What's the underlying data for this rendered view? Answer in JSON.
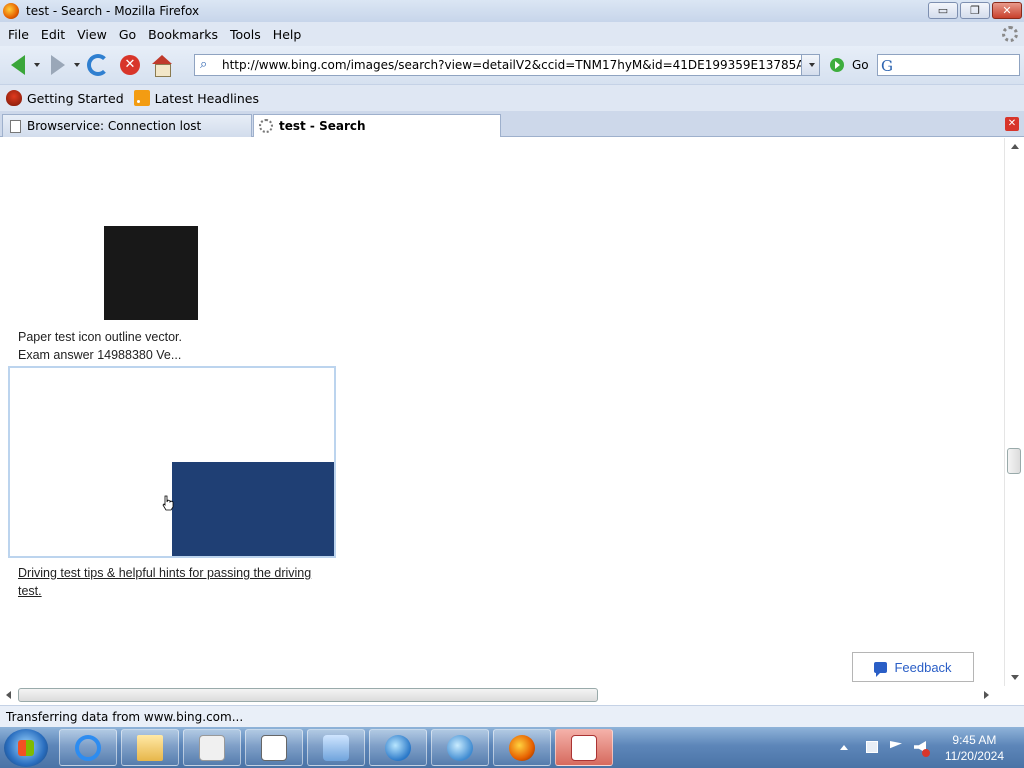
{
  "window": {
    "title": "test - Search - Mozilla Firefox",
    "minimize": "▭",
    "restore": "❐",
    "close": "✕"
  },
  "menu": [
    "File",
    "Edit",
    "View",
    "Go",
    "Bookmarks",
    "Tools",
    "Help"
  ],
  "navbar": {
    "url": "http://www.bing.com/images/search?view=detailV2&ccid=TNM17hyM&id=41DE199359E13785A78F114426BA",
    "go_label": "Go",
    "search_placeholder": ""
  },
  "bookmarks": [
    "Getting Started",
    "Latest Headlines"
  ],
  "tabs": [
    {
      "label": "Browservice: Connection lost",
      "active": false
    },
    {
      "label": "test - Search",
      "active": true
    }
  ],
  "content": {
    "caption1_line1": "Paper test icon outline vector.",
    "caption1_line2": "Exam answer 14988380 Ve...",
    "caption2_line1": "Driving test tips & helpful hints for passing the driving",
    "caption2_line2": "test.",
    "feedback_label": "Feedback",
    "thumb1_color": "#181818",
    "thumb2_color": "#1f3f74"
  },
  "status": "Transferring data from www.bing.com...",
  "taskbar": {
    "items": [
      "internet-explorer",
      "file-explorer",
      "media-player",
      "document",
      "control-panel",
      "network-globe",
      "network-tasks",
      "firefox",
      "snipping-tool"
    ],
    "time": "9:45 AM",
    "date": "11/20/2024"
  }
}
